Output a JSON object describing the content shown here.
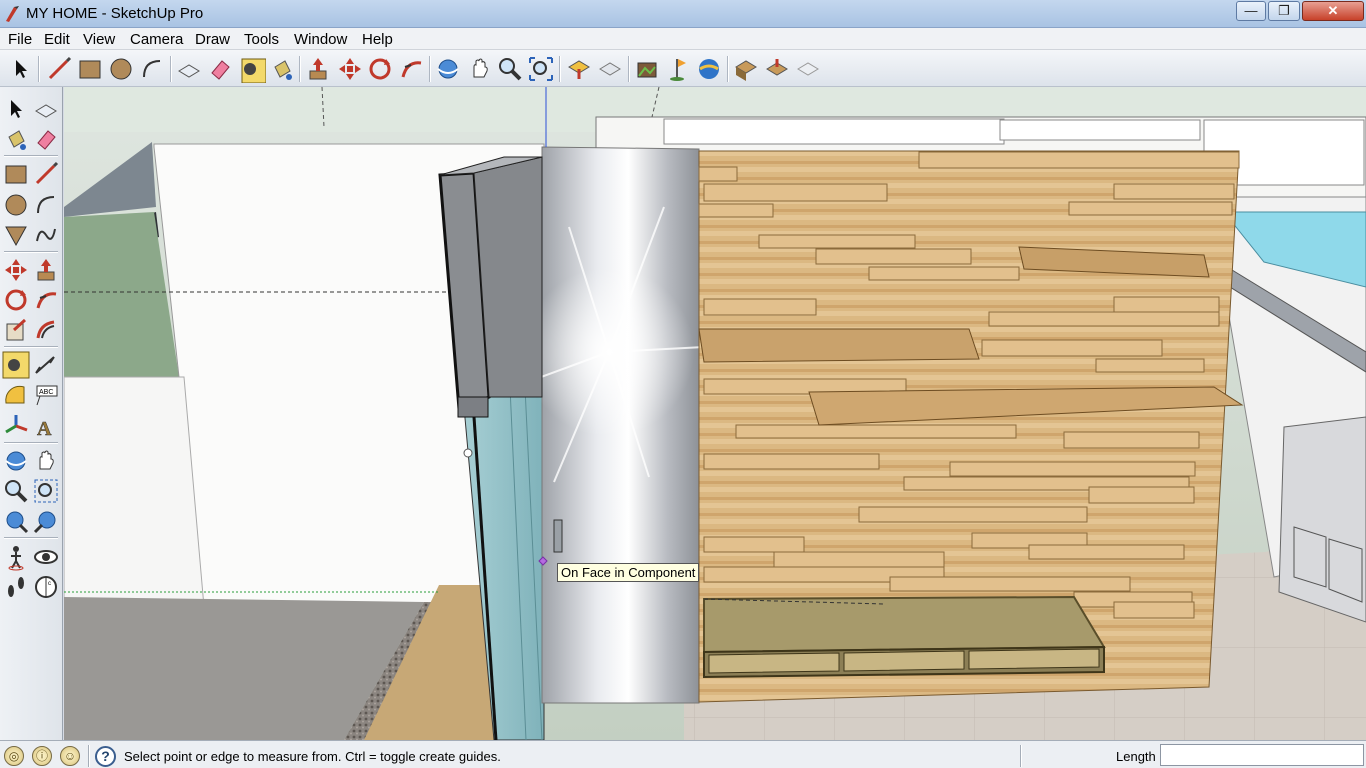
{
  "window": {
    "title": "MY HOME - SketchUp Pro",
    "min_label": "—",
    "max_label": "❐",
    "close_label": "✕"
  },
  "menu": [
    "File",
    "Edit",
    "View",
    "Camera",
    "Draw",
    "Tools",
    "Window",
    "Help"
  ],
  "toolbar_icons": [
    "select-icon",
    "line-icon",
    "rectangle-icon",
    "circle-icon",
    "arc-icon",
    "make-component-icon",
    "eraser-icon",
    "tape-measure-icon",
    "paint-bucket-icon",
    "push-pull-icon",
    "move-icon",
    "rotate-icon",
    "follow-me-icon",
    "orbit-icon",
    "pan-icon",
    "zoom-icon",
    "zoom-extents-icon",
    "get-models-icon",
    "share-model-icon",
    "get-photo-texture-icon",
    "add-location-icon",
    "google-earth-icon",
    "components-icon",
    "share-component-icon",
    "extension-warehouse-icon"
  ],
  "left_toolbar_icons": [
    "select-icon",
    "make-component-icon",
    "paint-bucket-icon",
    "eraser-icon",
    "rectangle-icon",
    "line-icon",
    "circle-icon",
    "arc-icon",
    "polygon-icon",
    "freehand-icon",
    "move-icon",
    "push-pull-icon",
    "rotate-icon",
    "follow-me-icon",
    "scale-icon",
    "offset-icon",
    "tape-measure-icon",
    "dimension-icon",
    "protractor-icon",
    "text-icon",
    "axes-icon",
    "3d-text-icon",
    "orbit-icon",
    "pan-icon",
    "zoom-icon",
    "zoom-window-icon",
    "zoom-extents-icon",
    "previous-view-icon",
    "position-camera-icon",
    "look-around-icon",
    "walk-icon",
    "section-plane-icon"
  ],
  "viewport": {
    "tooltip": "On Face in Component"
  },
  "status": {
    "icons": [
      "geo-location-icon",
      "credits-icon",
      "user-icon"
    ],
    "message": "Select point or edge to measure from.  Ctrl = toggle create guides.",
    "vcb_label": "Length",
    "vcb_value": ""
  },
  "colors": {
    "accent": "#3b6ea5",
    "wood": "#d9b47e",
    "metal": "#b9bcc2",
    "glass": "#8ed8e8"
  }
}
